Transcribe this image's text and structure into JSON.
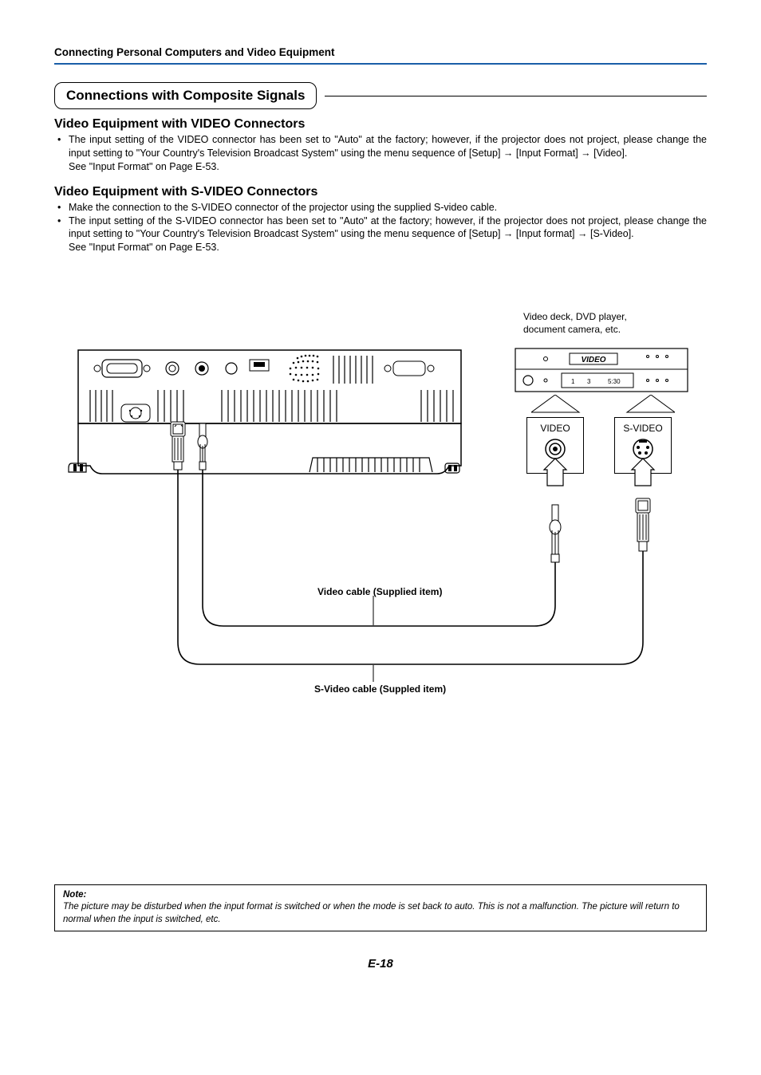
{
  "header": "Connecting Personal Computers and Video Equipment",
  "section_title": "Connections with Composite Signals",
  "sub1": {
    "heading": "Video Equipment with VIDEO Connectors",
    "bullet1": "The input setting of the VIDEO connector has been set to \"Auto\" at the factory; however, if the projector does not project, please change the input setting to \"Your Country's Television Broadcast System\" using the menu sequence of [Setup] → [Input Format] → [Video].",
    "see": "See \"Input Format\" on Page E-53."
  },
  "sub2": {
    "heading": "Video Equipment with S-VIDEO Connectors",
    "bullet1": "Make the connection to the S-VIDEO connector of the projector using the supplied S-video cable.",
    "bullet2": "The input setting of the S-VIDEO connector has been set to \"Auto\" at the factory; however, if the projector does not project, please change the input setting to \"Your Country's Television Broadcast System\" using the menu sequence of [Setup] → [Input format] → [S-Video].",
    "see": "See \"Input Format\" on Page E-53."
  },
  "diagram": {
    "source_caption": "Video deck, DVD player, document camera, etc.",
    "video_label": "VIDEO",
    "svideo_label": "S-VIDEO",
    "cable1": "Video cable (Supplied item)",
    "cable2": "S-Video cable (Suppled item)",
    "display_text": "VIDEO",
    "time": "5:30"
  },
  "note": {
    "heading": "Note:",
    "body": "The picture may be disturbed when the input format is switched or when the mode is set back to auto. This is not a malfunction. The picture will return to normal when the input is switched, etc."
  },
  "page_number": "E-18"
}
